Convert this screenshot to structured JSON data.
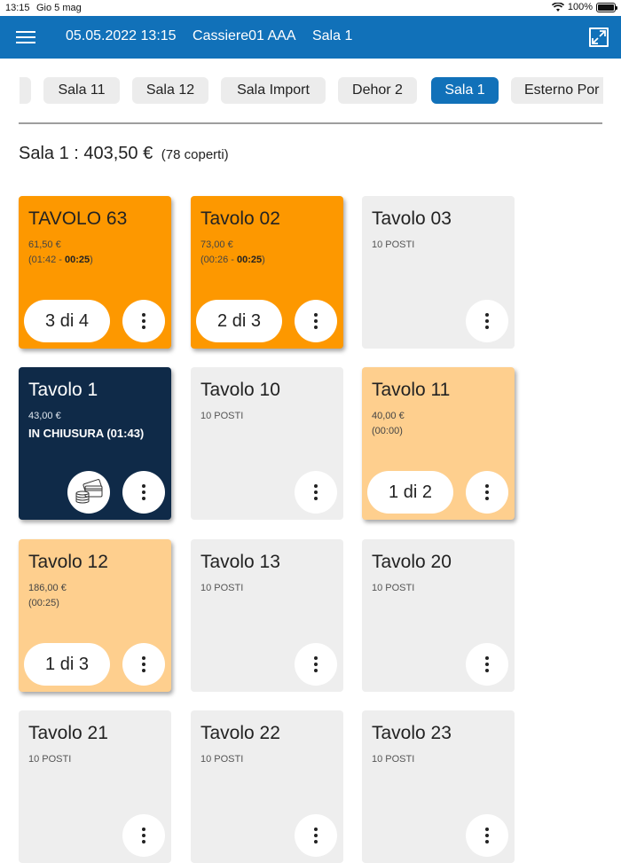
{
  "status_bar": {
    "time": "13:15",
    "date": "Gio 5 mag",
    "battery": "100%"
  },
  "app_bar": {
    "datetime": "05.05.2022 13:15",
    "cashier": "Cassiere01 AAA",
    "room": "Sala 1"
  },
  "tabs": [
    {
      "label": "Sala 11",
      "active": false
    },
    {
      "label": "Sala 12",
      "active": false
    },
    {
      "label": "Sala Import",
      "active": false
    },
    {
      "label": "Dehor 2",
      "active": false
    },
    {
      "label": "Sala 1",
      "active": true
    },
    {
      "label": "Esterno Por",
      "active": false
    }
  ],
  "summary": {
    "title": "Sala 1 : 403,50 €",
    "coperti": "(78 coperti)"
  },
  "tables": [
    {
      "name": "TAVOLO 63",
      "amount": "61,50 €",
      "times": "(01:42 - ",
      "elapsed": "00:25",
      "close": ")",
      "bill": "3 di 4"
    },
    {
      "name": "Tavolo 02",
      "amount": "73,00 €",
      "times": "(00:26 - ",
      "elapsed": "00:25",
      "close": ")",
      "bill": "2 di 3"
    },
    {
      "name": "Tavolo 03",
      "seats": "10 POSTI"
    },
    {
      "name": "Tavolo 1",
      "amount": "43,00 €",
      "status": "IN CHIUSURA (01:43)"
    },
    {
      "name": "Tavolo 10",
      "seats": "10 POSTI"
    },
    {
      "name": "Tavolo 11",
      "amount": "40,00 €",
      "times": "(00:00)",
      "bill": "1 di 2"
    },
    {
      "name": "Tavolo 12",
      "amount": "186,00 €",
      "times": "(00:25)",
      "bill": "1 di 3"
    },
    {
      "name": "Tavolo 13",
      "seats": "10 POSTI"
    },
    {
      "name": "Tavolo 20",
      "seats": "10 POSTI"
    },
    {
      "name": "Tavolo 21",
      "seats": "10 POSTI"
    },
    {
      "name": "Tavolo 22",
      "seats": "10 POSTI"
    },
    {
      "name": "Tavolo 23",
      "seats": "10 POSTI"
    }
  ],
  "colors": {
    "primary": "#1171b9",
    "busy": "#fd9800",
    "open": "#fecf8e",
    "closing": "#0f2a48",
    "free": "#eeeeee"
  },
  "icons": {
    "menu": "hamburger-icon",
    "expand": "expand-icon",
    "more": "more-vertical-icon",
    "pay": "pay-cards-icon"
  }
}
